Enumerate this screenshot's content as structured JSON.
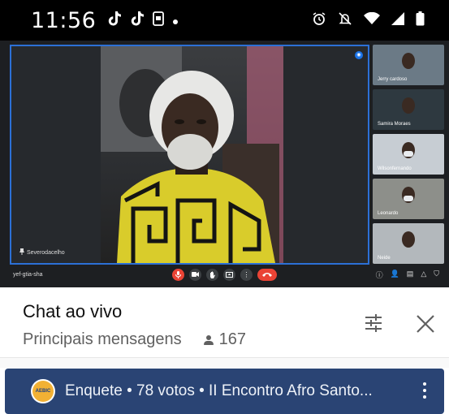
{
  "status_bar": {
    "time": "11:56",
    "left_icons": [
      "tiktok-icon",
      "tiktok-icon",
      "screenshot-icon",
      "dot-icon"
    ],
    "right_icons": [
      "alarm-icon",
      "mute-icon",
      "wifi-icon",
      "signal-icon",
      "battery-icon"
    ]
  },
  "video": {
    "speaker_name": "Severodacelho",
    "meeting_code": "yef-gtia-sha",
    "participants": [
      {
        "name": "Jerry cardoso",
        "bg": "#6b7a86"
      },
      {
        "name": "Samira Moraes",
        "bg": "#2e3940"
      },
      {
        "name": "Wilsonfernando",
        "bg": "#c7cdd3"
      },
      {
        "name": "Leonardo",
        "bg": "#8d8f8a"
      },
      {
        "name": "Neide",
        "bg": "#b3b8bc"
      }
    ],
    "controls": [
      "mic-off-icon",
      "camera-icon",
      "hand-icon",
      "present-icon",
      "more-icon",
      "end-call-icon"
    ]
  },
  "chat": {
    "title": "Chat ao vivo",
    "filter": "Principais mensagens",
    "viewers": "167"
  },
  "poll": {
    "text": "Enquete • 78 votos • II Encontro Afro Santo...",
    "logo_text": "AEBIC"
  },
  "colors": {
    "poll_bg": "#2a4474",
    "accent_red": "#e53935",
    "active_speaker_border": "#2c70d6"
  }
}
